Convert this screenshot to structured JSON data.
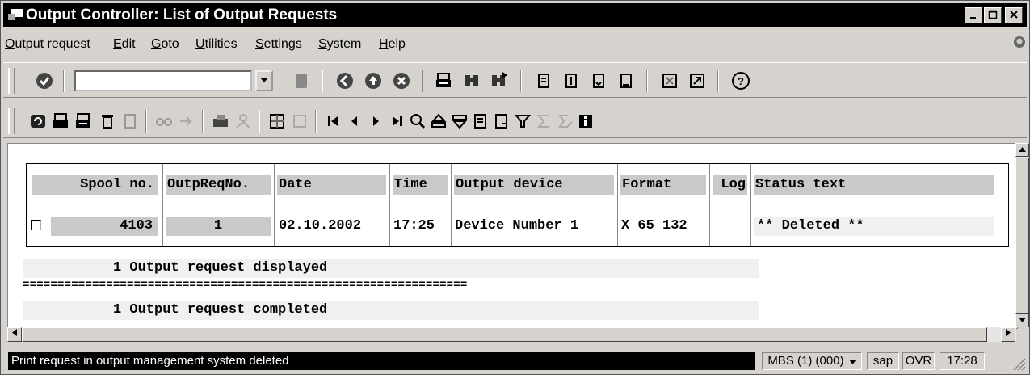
{
  "window": {
    "title": "Output Controller: List of Output Requests",
    "min_icon": "minimize-icon",
    "max_icon": "maximize-icon",
    "close_icon": "close-icon"
  },
  "menu": [
    "Output request",
    "Edit",
    "Goto",
    "Utilities",
    "Settings",
    "System",
    "Help"
  ],
  "command_field": {
    "value": ""
  },
  "table": {
    "headers": {
      "spool": "Spool no.",
      "outpreq": "OutpReqNo.",
      "date": "Date",
      "time": "Time",
      "device": "Output device",
      "format": "Format",
      "log": "Log",
      "status": "Status text"
    },
    "row": {
      "spool": "4103",
      "outpreq": "1",
      "date": "02.10.2002",
      "time": "17:25",
      "device": "Device Number 1",
      "format": "X_65_132",
      "log": "",
      "status": "** Deleted **"
    }
  },
  "summary": {
    "displayed": "1 Output request displayed",
    "divider": "================================================================",
    "completed": "1 Output request completed"
  },
  "statusbar": {
    "message": "Print request in output management system deleted",
    "system": "MBS (1) (000)",
    "server": "sap",
    "mode": "OVR",
    "time": "17:28"
  }
}
